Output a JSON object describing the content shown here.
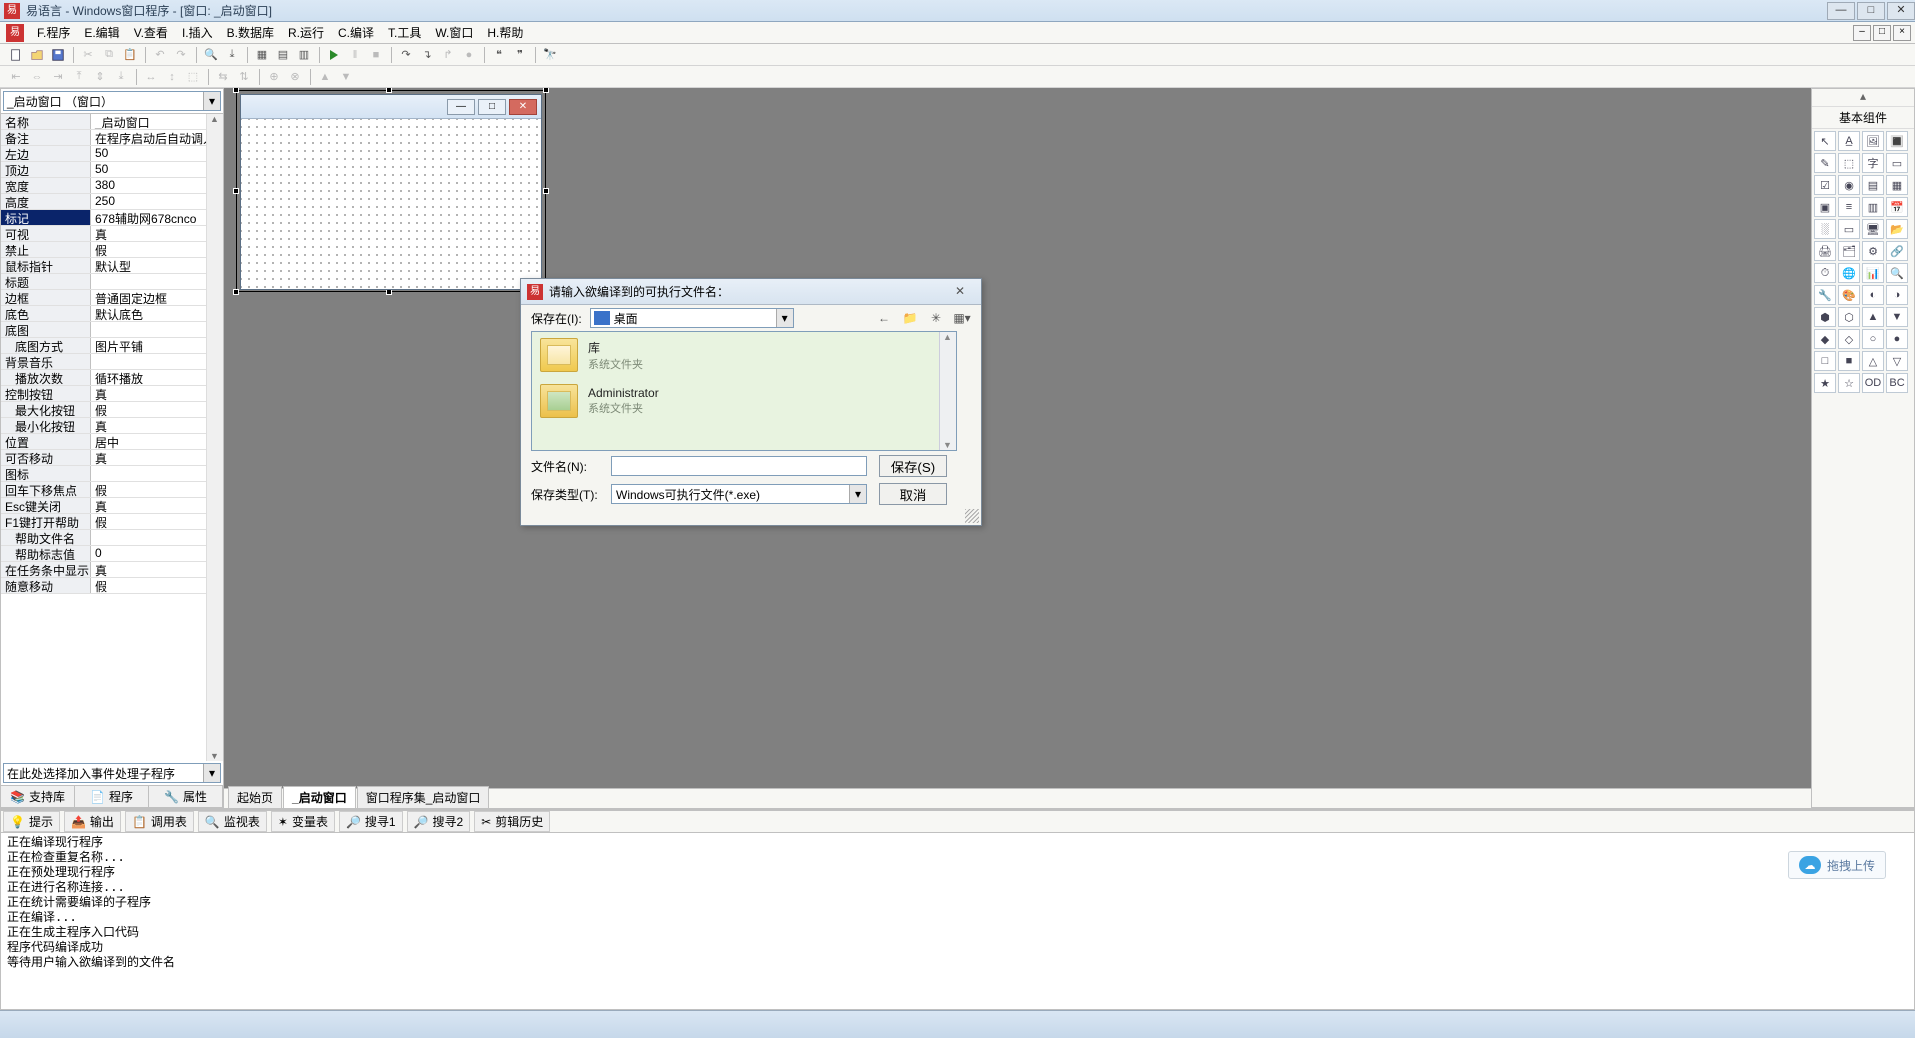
{
  "titlebar": {
    "text": "易语言 - Windows窗口程序 - [窗口: _启动窗口]"
  },
  "menu": {
    "items": [
      "F.程序",
      "E.编辑",
      "V.查看",
      "I.插入",
      "B.数据库",
      "R.运行",
      "C.编译",
      "T.工具",
      "W.窗口",
      "H.帮助"
    ]
  },
  "object_combo": {
    "text": "_启动窗口 （窗口）"
  },
  "props": [
    {
      "k": "名称",
      "v": "_启动窗口"
    },
    {
      "k": "备注",
      "v": "在程序启动后自动调入"
    },
    {
      "k": "左边",
      "v": "50"
    },
    {
      "k": "顶边",
      "v": "50"
    },
    {
      "k": "宽度",
      "v": "380"
    },
    {
      "k": "高度",
      "v": "250"
    },
    {
      "k": "标记",
      "v": "678辅助网678cnco",
      "sel": true,
      "more": true
    },
    {
      "k": "可视",
      "v": "真"
    },
    {
      "k": "禁止",
      "v": "假"
    },
    {
      "k": "鼠标指针",
      "v": "默认型"
    },
    {
      "k": "标题",
      "v": ""
    },
    {
      "k": "边框",
      "v": "普通固定边框"
    },
    {
      "k": "底色",
      "v": "默认底色"
    },
    {
      "k": "底图",
      "v": ""
    },
    {
      "k": "底图方式",
      "v": "图片平铺",
      "indent": true
    },
    {
      "k": "背景音乐",
      "v": ""
    },
    {
      "k": "播放次数",
      "v": "循环播放",
      "indent": true
    },
    {
      "k": "控制按钮",
      "v": "真"
    },
    {
      "k": "最大化按钮",
      "v": "假",
      "indent": true
    },
    {
      "k": "最小化按钮",
      "v": "真",
      "indent": true
    },
    {
      "k": "位置",
      "v": "居中"
    },
    {
      "k": "可否移动",
      "v": "真"
    },
    {
      "k": "图标",
      "v": ""
    },
    {
      "k": "回车下移焦点",
      "v": "假"
    },
    {
      "k": "Esc键关闭",
      "v": "真"
    },
    {
      "k": "F1键打开帮助",
      "v": "假"
    },
    {
      "k": "帮助文件名",
      "v": "",
      "indent": true
    },
    {
      "k": "帮助标志值",
      "v": "0",
      "indent": true
    },
    {
      "k": "在任务条中显示",
      "v": "真"
    },
    {
      "k": "随意移动",
      "v": "假"
    }
  ],
  "event_combo": {
    "text": "在此处选择加入事件处理子程序"
  },
  "left_tabs": {
    "a": "支持库",
    "b": "程序",
    "c": "属性"
  },
  "center_tabs": {
    "a": "起始页",
    "b": "_启动窗口",
    "c": "窗口程序集_启动窗口"
  },
  "right": {
    "title": "基本组件"
  },
  "output": {
    "tabs": [
      "提示",
      "输出",
      "调用表",
      "监视表",
      "变量表",
      "搜寻1",
      "搜寻2",
      "剪辑历史"
    ],
    "lines": [
      "正在编译现行程序",
      "正在检查重复名称...",
      "正在预处理现行程序",
      "正在进行名称连接...",
      "正在统计需要编译的子程序",
      "正在编译...",
      "正在生成主程序入口代码",
      "程序代码编译成功",
      "等待用户输入欲编译到的文件名"
    ],
    "upload_label": "拖拽上传"
  },
  "dialog": {
    "title": "请输入欲编译到的可执行文件名：",
    "save_in_label": "保存在(I):",
    "save_in_value": "桌面",
    "items": [
      {
        "name": "库",
        "sub": "系统文件夹"
      },
      {
        "name": "Administrator",
        "sub": "系统文件夹"
      }
    ],
    "filename_label": "文件名(N):",
    "filename_value": "",
    "filetype_label": "保存类型(T):",
    "filetype_value": "Windows可执行文件(*.exe)",
    "save_btn": "保存(S)",
    "cancel_btn": "取消"
  }
}
